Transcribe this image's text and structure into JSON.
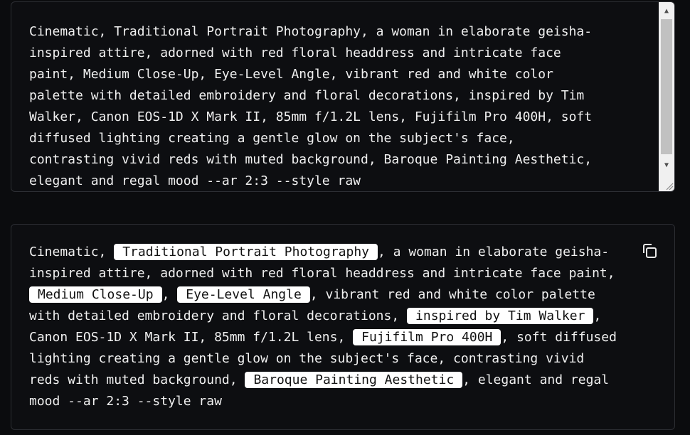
{
  "editor": {
    "text": "Cinematic, Traditional Portrait Photography, a woman in elaborate geisha-\ninspired attire, adorned with red floral headdress and intricate face\npaint, Medium Close-Up, Eye-Level Angle, vibrant red and white color\npalette with detailed embroidery and floral decorations, inspired by Tim\nWalker, Canon EOS-1D X Mark II, 85mm f/1.2L lens, Fujifilm Pro 400H, soft\ndiffused lighting creating a gentle glow on the subject's face,\ncontrasting vivid reds with muted background, Baroque Painting Aesthetic,\nelegant and regal mood --ar 2:3 --style raw"
  },
  "preview": {
    "segments": [
      {
        "text": "Cinematic, ",
        "chip": false
      },
      {
        "text": "Traditional Portrait Photography",
        "chip": true
      },
      {
        "text": ", a woman in elaborate geisha-\ninspired attire, adorned with red floral headdress and intricate face paint,\n",
        "chip": false
      },
      {
        "text": "Medium Close-Up",
        "chip": true
      },
      {
        "text": ", ",
        "chip": false
      },
      {
        "text": "Eye-Level Angle",
        "chip": true
      },
      {
        "text": ", vibrant red and white color palette\nwith detailed embroidery and floral decorations, ",
        "chip": false
      },
      {
        "text": "inspired by Tim Walker",
        "chip": true
      },
      {
        "text": ",\nCanon EOS-1D X Mark II, 85mm f/1.2L lens, ",
        "chip": false
      },
      {
        "text": "Fujifilm Pro 400H",
        "chip": true
      },
      {
        "text": ", soft diffused\nlighting creating a gentle glow on the subject's face, contrasting vivid\nreds with muted background, ",
        "chip": false
      },
      {
        "text": "Baroque Painting Aesthetic",
        "chip": true
      },
      {
        "text": ", elegant and regal\nmood --ar 2:3 --style raw",
        "chip": false
      }
    ]
  },
  "icons": {
    "copy": "copy-icon",
    "scroll_up": "scroll-up-arrow-icon",
    "scroll_down": "scroll-down-arrow-icon",
    "resize": "resize-grip-icon"
  },
  "colors": {
    "background": "#0b0c0e",
    "chip_background": "#ffffff",
    "chip_text": "#111111",
    "text": "#f0f0f0"
  }
}
